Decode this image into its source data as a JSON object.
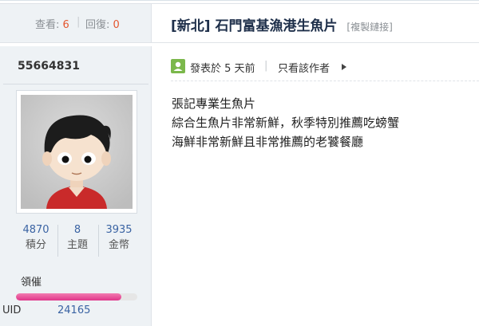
{
  "header": {
    "views_label": "查看:",
    "views_count": "6",
    "replies_label": "回復:",
    "replies_count": "0",
    "separator": "|",
    "thread_title": "[新北] 石門富基漁港生魚片",
    "copy_link": "[複製鏈接]"
  },
  "author": {
    "username": "55664831",
    "stats": [
      {
        "value": "4870",
        "label": "積分"
      },
      {
        "value": "8",
        "label": "主題"
      },
      {
        "value": "3935",
        "label": "金幣"
      }
    ],
    "rank_title": "領催",
    "rank_progress": 0.87,
    "uid_label": "UID",
    "uid_value": "24165"
  },
  "post": {
    "posted_text": "發表於 5 天前",
    "separator": "|",
    "author_only": "只看該作者",
    "lines": [
      "張記專業生魚片",
      "綜合生魚片非常新鮮，秋季特別推薦吃螃蟹",
      "海鮮非常新鮮且非常推薦的老饕餐廳"
    ]
  },
  "colors": {
    "accent_red": "#e4562e",
    "link_blue": "#3a63a3",
    "sidebar_bg": "#eef2f5",
    "rank_pink": "#e0358a"
  },
  "icons": {
    "post_icon": "post-user-icon",
    "author_arrow": "triangle-right-icon"
  }
}
